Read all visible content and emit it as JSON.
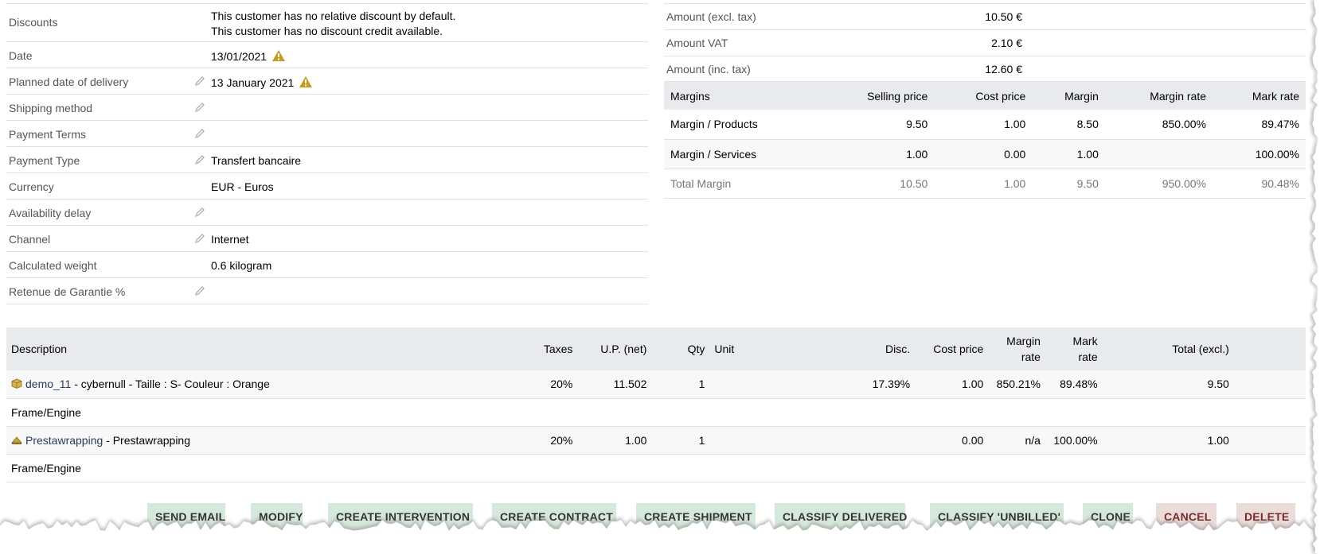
{
  "fields": {
    "discounts": {
      "label": "Discounts",
      "line1": "This customer has no relative discount by default.",
      "line2": "This customer has no discount credit available."
    },
    "date": {
      "label": "Date",
      "value": "13/01/2021"
    },
    "planned_delivery": {
      "label": "Planned date of delivery",
      "value": "13 January 2021"
    },
    "shipping_method": {
      "label": "Shipping method",
      "value": ""
    },
    "payment_terms": {
      "label": "Payment Terms",
      "value": ""
    },
    "payment_type": {
      "label": "Payment Type",
      "value": "Transfert bancaire"
    },
    "currency": {
      "label": "Currency",
      "value": "EUR - Euros"
    },
    "availability_delay": {
      "label": "Availability delay",
      "value": ""
    },
    "channel": {
      "label": "Channel",
      "value": "Internet"
    },
    "calculated_weight": {
      "label": "Calculated weight",
      "value": "0.6 kilogram"
    },
    "retenue": {
      "label": "Retenue de Garantie %",
      "value": ""
    }
  },
  "amounts": {
    "excl_label": "Amount (excl. tax)",
    "excl_value": "10.50 €",
    "vat_label": "Amount VAT",
    "vat_value": "2.10 €",
    "inc_label": "Amount (inc. tax)",
    "inc_value": "12.60 €"
  },
  "margins": {
    "headers": [
      "Margins",
      "Selling price",
      "Cost price",
      "Margin",
      "Margin rate",
      "Mark rate"
    ],
    "rows": [
      [
        "Margin / Products",
        "9.50",
        "1.00",
        "8.50",
        "850.00%",
        "89.47%"
      ],
      [
        "Margin / Services",
        "1.00",
        "0.00",
        "1.00",
        "",
        "100.00%"
      ],
      [
        "Total Margin",
        "10.50",
        "1.00",
        "9.50",
        "950.00%",
        "90.48%"
      ]
    ]
  },
  "lines": {
    "headers": {
      "description": "Description",
      "taxes": "Taxes",
      "up_net": "U.P. (net)",
      "qty": "Qty",
      "unit": "Unit",
      "disc": "Disc.",
      "cost_price": "Cost price",
      "margin_rate_1": "Margin",
      "margin_rate_2": "rate",
      "mark_rate_1": "Mark",
      "mark_rate_2": "rate",
      "total_excl": "Total (excl.)"
    },
    "rows": [
      {
        "ref": "demo_11",
        "desc": " - cybernull - Taille : S- Couleur : Orange",
        "taxes": "20%",
        "up": "11.502",
        "qty": "1",
        "unit": "",
        "disc": "17.39%",
        "cost": "1.00",
        "margin_rate": "850.21%",
        "mark_rate": "89.48%",
        "total": "9.50",
        "sub": "Frame/Engine"
      },
      {
        "ref": "Prestawrapping",
        "desc": " - Prestawrapping",
        "taxes": "20%",
        "up": "1.00",
        "qty": "1",
        "unit": "",
        "disc": "",
        "cost": "0.00",
        "margin_rate": "n/a",
        "mark_rate": "100.00%",
        "total": "1.00",
        "sub": "Frame/Engine"
      }
    ]
  },
  "actions": {
    "send_email": "SEND EMAIL",
    "modify": "MODIFY",
    "create_intervention": "CREATE INTERVENTION",
    "create_contract": "CREATE CONTRACT",
    "create_shipment": "CREATE SHIPMENT",
    "classify_delivered": "CLASSIFY DELIVERED",
    "classify_unbilled": "CLASSIFY 'UNBILLED'",
    "clone": "CLONE",
    "cancel": "CANCEL",
    "delete": "DELETE"
  },
  "colors": {
    "button_green": "#d5e8dc",
    "button_red": "#eaddd9",
    "header_gray": "#e9eaed",
    "link": "#263c5c",
    "warning": "#c99a1e"
  }
}
